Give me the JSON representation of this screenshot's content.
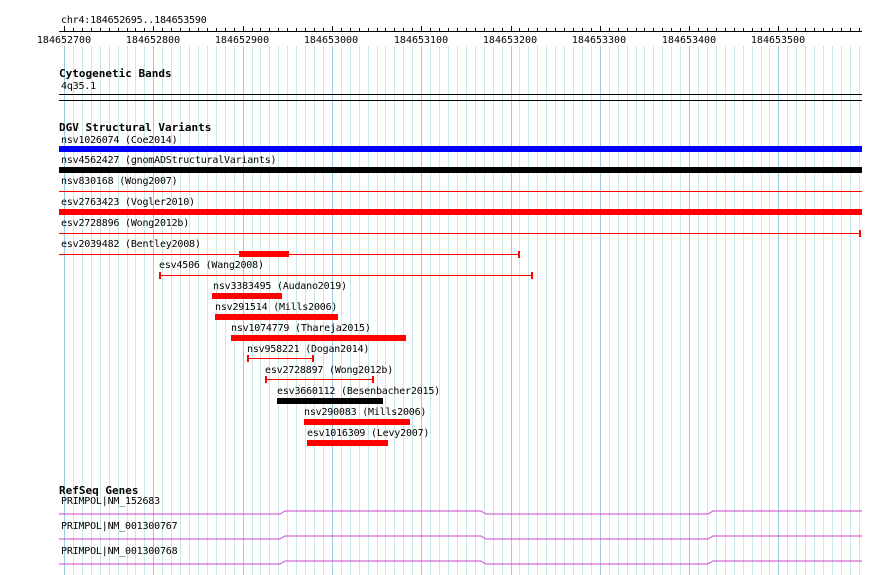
{
  "locus": "chr4:184652695..184653590",
  "ruler_ticks": [
    "184652700",
    "184652800",
    "184652900",
    "184653000",
    "184653100",
    "184653200",
    "184653300",
    "184653400",
    "184653500"
  ],
  "tracks": {
    "cytoband": {
      "title": "Cytogenetic Bands",
      "band": "4q35.1"
    },
    "dgv": {
      "title": "DGV Structural Variants",
      "features": [
        {
          "label": "nsv1026074 (Coe2014)",
          "color": "#0000ff"
        },
        {
          "label": "nsv4562427 (gnomADStructuralVariants)",
          "color": "#000000"
        },
        {
          "label": "nsv830168 (Wong2007)",
          "color": "#ff0000"
        },
        {
          "label": "esv2763423 (Vogler2010)",
          "color": "#ff0000"
        },
        {
          "label": "esv2728896 (Wong2012b)",
          "color": "#ff0000"
        },
        {
          "label": "esv2039482 (Bentley2008)",
          "color": "#ff0000"
        },
        {
          "label": "esv4506 (Wang2008)",
          "color": "#ff0000"
        },
        {
          "label": "nsv3383495 (Audano2019)",
          "color": "#ff0000"
        },
        {
          "label": "nsv291514 (Mills2006)",
          "color": "#ff0000"
        },
        {
          "label": "nsv1074779 (Thareja2015)",
          "color": "#ff0000"
        },
        {
          "label": "nsv958221 (Dogan2014)",
          "color": "#ff0000"
        },
        {
          "label": "esv2728897 (Wong2012b)",
          "color": "#ff0000"
        },
        {
          "label": "esv3660112 (Besenbacher2015)",
          "color": "#000000"
        },
        {
          "label": "nsv290083 (Mills2006)",
          "color": "#ff0000"
        },
        {
          "label": "esv1016309 (Levy2007)",
          "color": "#ff0000"
        }
      ]
    },
    "refseq": {
      "title": "RefSeq Genes",
      "genes": [
        {
          "label": "PRIMPOL|NM_152683",
          "color": "#cc44cc"
        },
        {
          "label": "PRIMPOL|NM_001300767",
          "color": "#cc44cc"
        },
        {
          "label": "PRIMPOL|NM_001300768",
          "color": "#cc44cc"
        }
      ]
    }
  }
}
